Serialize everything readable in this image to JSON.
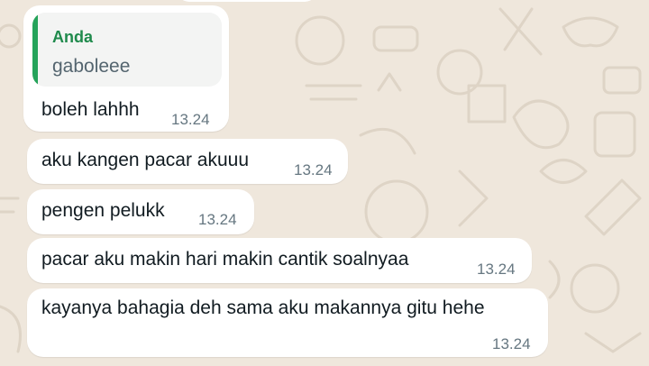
{
  "chat": {
    "reply": {
      "quoted_author": "Anda",
      "quoted_text": "gaboleee",
      "text": "boleh lahhh",
      "time": "13.24"
    },
    "messages": [
      {
        "text": "aku kangen pacar akuuu",
        "time": "13.24"
      },
      {
        "text": "pengen pelukk",
        "time": "13.24"
      },
      {
        "text": "pacar aku makin hari makin cantik soalnyaa",
        "time": "13.24"
      },
      {
        "text": "kayanya bahagia deh sama aku makannya gitu hehe",
        "time": "13.24"
      }
    ]
  },
  "colors": {
    "wallpaper": "#efe7dc",
    "bubble": "#ffffff",
    "quote_accent": "#25a35a",
    "timestamp": "#667781"
  }
}
